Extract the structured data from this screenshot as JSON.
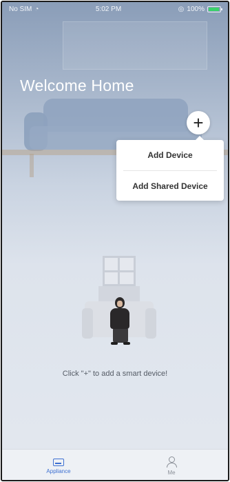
{
  "status_bar": {
    "carrier": "No SIM",
    "time": "5:02 PM",
    "battery": "100%",
    "battery_color": "#39d26a"
  },
  "header": {
    "title": "Welcome Home"
  },
  "add_menu": {
    "add_button_label": "+",
    "items": [
      {
        "label": "Add Device"
      },
      {
        "label": "Add Shared Device"
      }
    ]
  },
  "empty_state": {
    "hint": "Click \"+\" to add a smart device!"
  },
  "tab_bar": {
    "tabs": [
      {
        "label": "Appliance",
        "icon": "appliance-icon",
        "active": true
      },
      {
        "label": "Me",
        "icon": "person-icon",
        "active": false
      }
    ],
    "active_color": "#3c6fd1"
  }
}
